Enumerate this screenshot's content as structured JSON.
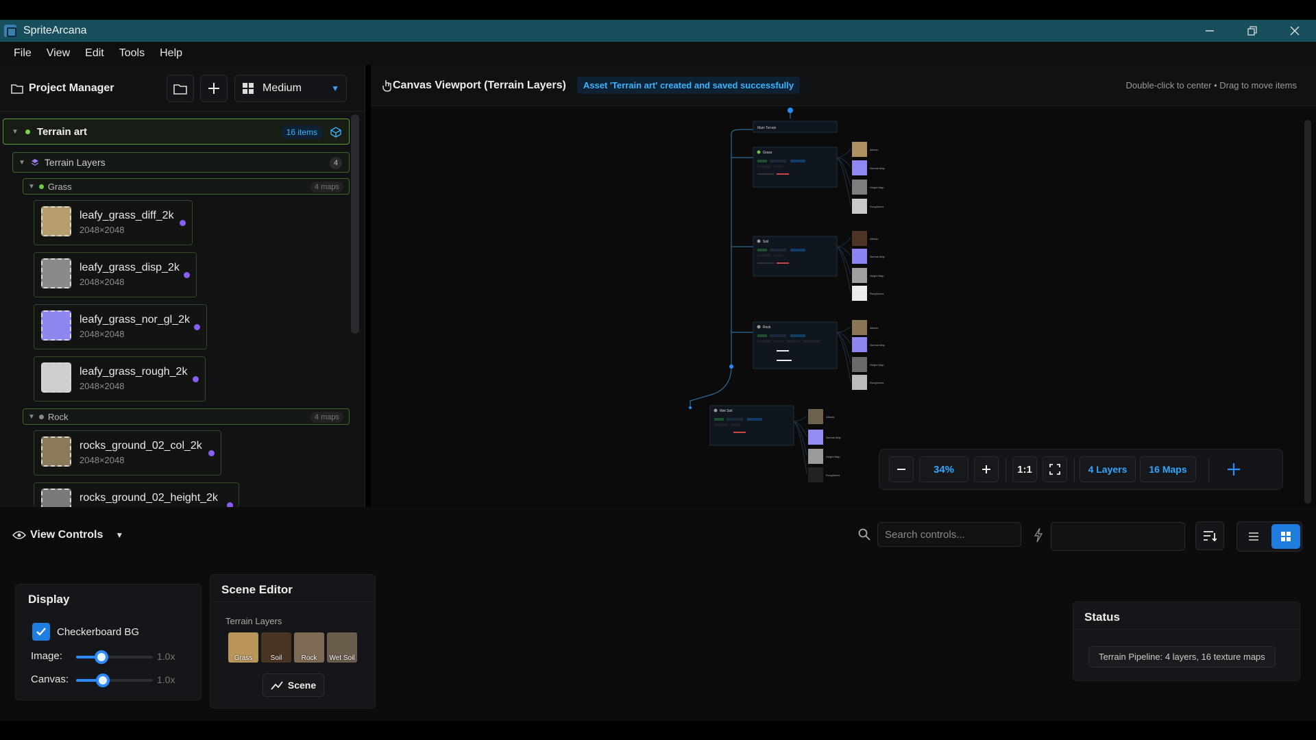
{
  "app": {
    "title": "SpriteArcana"
  },
  "menu": [
    "File",
    "View",
    "Edit",
    "Tools",
    "Help"
  ],
  "project_manager": {
    "title": "Project Manager",
    "size_select": "Medium",
    "root": {
      "name": "Terrain art",
      "count": "16 items"
    },
    "layers_group": {
      "name": "Terrain Layers",
      "count": "4"
    },
    "grass_group": {
      "name": "Grass",
      "count": "4 maps"
    },
    "rock_group": {
      "name": "Rock",
      "count": "4 maps"
    },
    "assets": [
      {
        "name": "leafy_grass_diff_2k",
        "dims": "2048×2048",
        "color": "#b59e6b"
      },
      {
        "name": "leafy_grass_disp_2k",
        "dims": "2048×2048",
        "color": "#8a8a8a"
      },
      {
        "name": "leafy_grass_nor_gl_2k",
        "dims": "2048×2048",
        "color": "#8d86ef"
      },
      {
        "name": "leafy_grass_rough_2k",
        "dims": "2048×2048",
        "color": "#cfcfcf"
      },
      {
        "name": "rocks_ground_02_col_2k",
        "dims": "2048×2048",
        "color": "#8a7a5a"
      },
      {
        "name": "rocks_ground_02_height_2k",
        "dims": "",
        "color": "#7a7a7a"
      }
    ]
  },
  "canvas": {
    "title": "Canvas Viewport (Terrain Layers)",
    "toast": "Asset 'Terrain art' created and saved successfully",
    "hint": "Double-click to center • Drag to move items",
    "zoom": "34%",
    "ratio": "1:1",
    "layers_badge": "4 Layers",
    "maps_badge": "16 Maps",
    "graph": {
      "root_label": "Main Terrain",
      "nodes": [
        "Grass",
        "Soil",
        "Rock",
        "Wet Soil"
      ],
      "map_labels": [
        "Albedo",
        "Normal Map",
        "Height Map",
        "Roughness"
      ]
    }
  },
  "controls": {
    "title": "View Controls",
    "search_placeholder": "Search controls..."
  },
  "display": {
    "title": "Display",
    "checkbox_label": "Checkerboard BG",
    "image_label": "Image:",
    "image_value": "1.0x",
    "image_level": 0.33,
    "canvas_label": "Canvas:",
    "canvas_value": "1.0x",
    "canvas_level": 0.35
  },
  "scene_editor": {
    "title": "Scene Editor",
    "section": "Terrain Layers",
    "swatches": [
      {
        "label": "Grass",
        "color": "#b8955a"
      },
      {
        "label": "Soil",
        "color": "#4a3424"
      },
      {
        "label": "Rock",
        "color": "#7e6a52"
      },
      {
        "label": "Wet Soil",
        "color": "#6b5d4c"
      }
    ],
    "scene_button": "Scene"
  },
  "status": {
    "title": "Status",
    "text": "Terrain Pipeline: 4 layers, 16 texture maps"
  }
}
